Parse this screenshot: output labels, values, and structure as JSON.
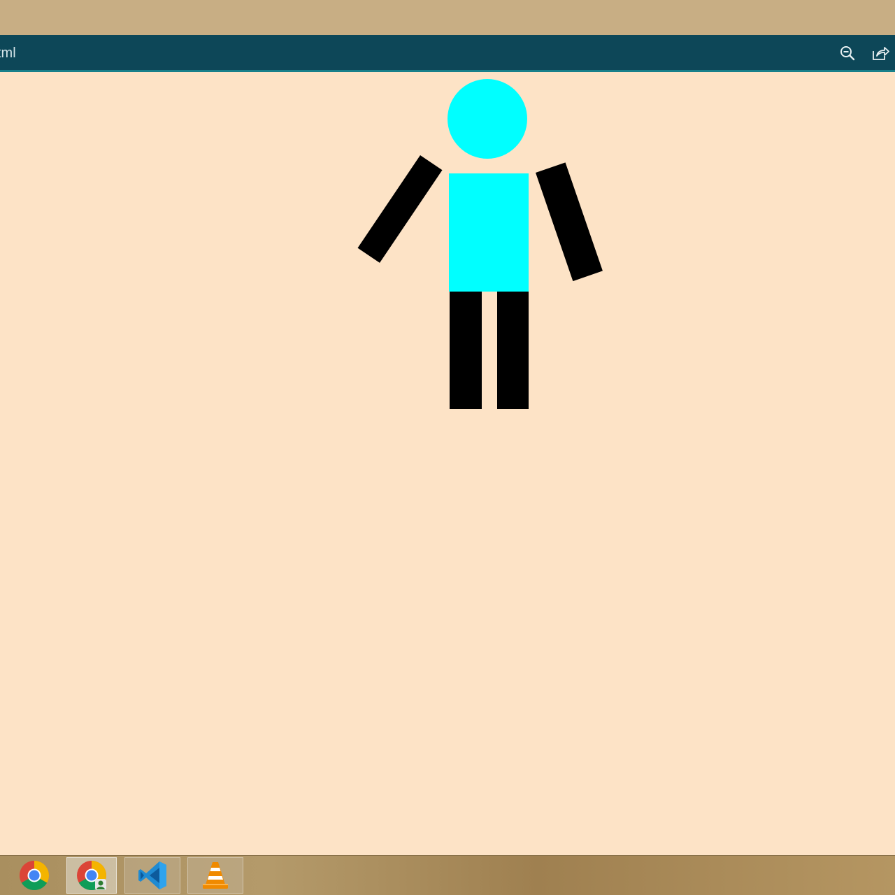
{
  "window": {
    "title": "tml"
  },
  "toolbar": {
    "icons": [
      "zoom-out-icon",
      "share-icon"
    ]
  },
  "canvas": {
    "background": "#fde3c6",
    "figure_color": "#00ffff",
    "limb_color": "#000000"
  },
  "taskbar": {
    "apps": [
      "chrome-icon",
      "chrome-user-icon",
      "vscode-icon",
      "vlc-icon"
    ]
  }
}
